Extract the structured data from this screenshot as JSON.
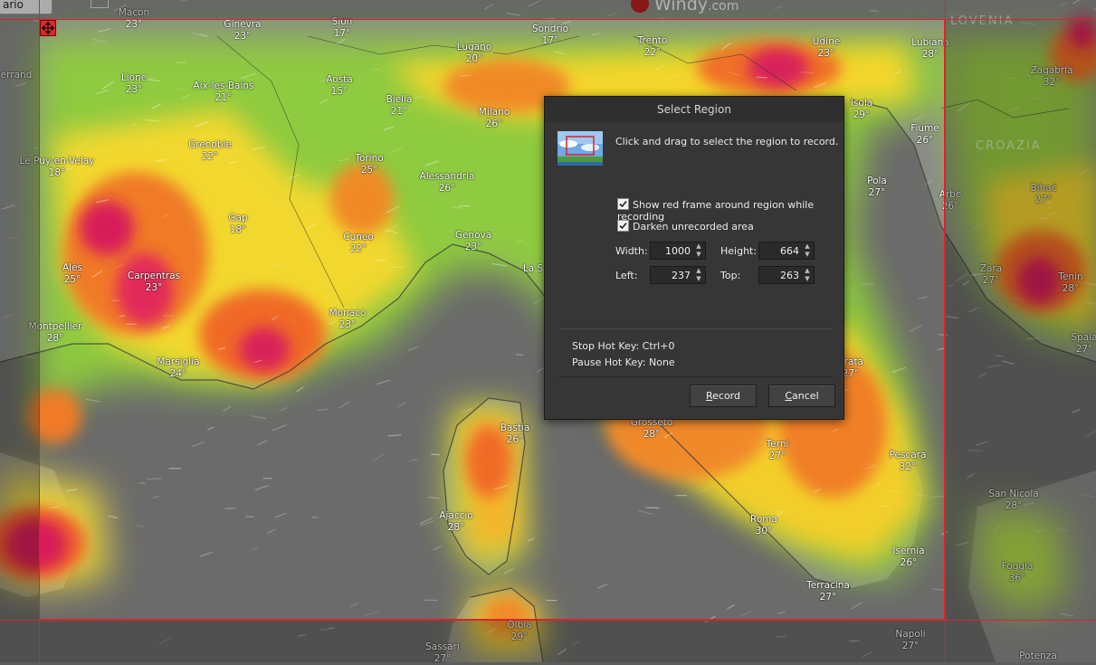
{
  "app": {
    "logo_text": "Windy",
    "logo_suffix": ".com"
  },
  "corner_field": {
    "value": "ario"
  },
  "dialog": {
    "title": "Select Region",
    "instruction": "Click and drag to select the region to record.",
    "checkboxes": [
      {
        "label": "Show red frame around region while recording",
        "checked": true
      },
      {
        "label": "Darken unrecorded area",
        "checked": true
      }
    ],
    "fields": {
      "width": {
        "label": "Width:",
        "value": "1000"
      },
      "height": {
        "label": "Height:",
        "value": "664"
      },
      "left": {
        "label": "Left:",
        "value": "237"
      },
      "top": {
        "label": "Top:",
        "value": "263"
      }
    },
    "stop_hotkey": "Stop Hot Key: Ctrl+0",
    "pause_hotkey": "Pause Hot Key: None",
    "record_label": "Record",
    "cancel_label": "Cancel"
  },
  "map": {
    "countries": [
      "LOVENIA",
      "CROAZIA"
    ],
    "cities": [
      {
        "name": "Macon",
        "temp": "23°"
      },
      {
        "name": "Ginevra",
        "temp": "23°"
      },
      {
        "name": "Sion",
        "temp": "17°"
      },
      {
        "name": "Lugano",
        "temp": "20°"
      },
      {
        "name": "Sondrio",
        "temp": "17°"
      },
      {
        "name": "Trento",
        "temp": "22°"
      },
      {
        "name": "Udine",
        "temp": "23°"
      },
      {
        "name": "Lubiana",
        "temp": "28°"
      },
      {
        "name": "Zagabria",
        "temp": "32°"
      },
      {
        "name": "errand",
        "temp": ""
      },
      {
        "name": "Lione",
        "temp": "23°"
      },
      {
        "name": "Aix-les-Bains",
        "temp": "21°"
      },
      {
        "name": "Aosta",
        "temp": "15°"
      },
      {
        "name": "Biella",
        "temp": "21°"
      },
      {
        "name": "Milano",
        "temp": "26°"
      },
      {
        "name": "Isola",
        "temp": "29°"
      },
      {
        "name": "Fiume",
        "temp": "26°"
      },
      {
        "name": "Grenoble",
        "temp": "22°"
      },
      {
        "name": "Torino",
        "temp": "25°"
      },
      {
        "name": "Alessandria",
        "temp": "26°"
      },
      {
        "name": "Le Puy-en-Velay",
        "temp": "18°"
      },
      {
        "name": "Pola",
        "temp": "27°"
      },
      {
        "name": "Arbe",
        "temp": "26°"
      },
      {
        "name": "Bihać",
        "temp": "27°"
      },
      {
        "name": "Gap",
        "temp": "18°"
      },
      {
        "name": "Cuneo",
        "temp": "22°"
      },
      {
        "name": "Genova",
        "temp": "23°"
      },
      {
        "name": "La S",
        "temp": ""
      },
      {
        "name": "Alès",
        "temp": "25°"
      },
      {
        "name": "Carpentras",
        "temp": "23°"
      },
      {
        "name": "Zara",
        "temp": "27°"
      },
      {
        "name": "Tenin",
        "temp": "28°"
      },
      {
        "name": "Monaco",
        "temp": "23°"
      },
      {
        "name": "Montpellier",
        "temp": "28°"
      },
      {
        "name": "Spala",
        "temp": "27°"
      },
      {
        "name": "Marsiglia",
        "temp": "24°"
      },
      {
        "name": "erata",
        "temp": "27°"
      },
      {
        "name": "Bastia",
        "temp": "26°"
      },
      {
        "name": "Grosseto",
        "temp": "28°"
      },
      {
        "name": "Terni",
        "temp": "27°"
      },
      {
        "name": "Pescara",
        "temp": "32°"
      },
      {
        "name": "San Nicola",
        "temp": "28°"
      },
      {
        "name": "Ajaccio",
        "temp": "28°"
      },
      {
        "name": "Roma",
        "temp": "30°"
      },
      {
        "name": "Isernia",
        "temp": "26°"
      },
      {
        "name": "Foggia",
        "temp": "36°"
      },
      {
        "name": "Terracina",
        "temp": "27°"
      },
      {
        "name": "Olbia",
        "temp": "29°"
      },
      {
        "name": "Sassari",
        "temp": "27°"
      },
      {
        "name": "Napoli",
        "temp": "27°"
      },
      {
        "name": "Potenza",
        "temp": ""
      }
    ]
  }
}
